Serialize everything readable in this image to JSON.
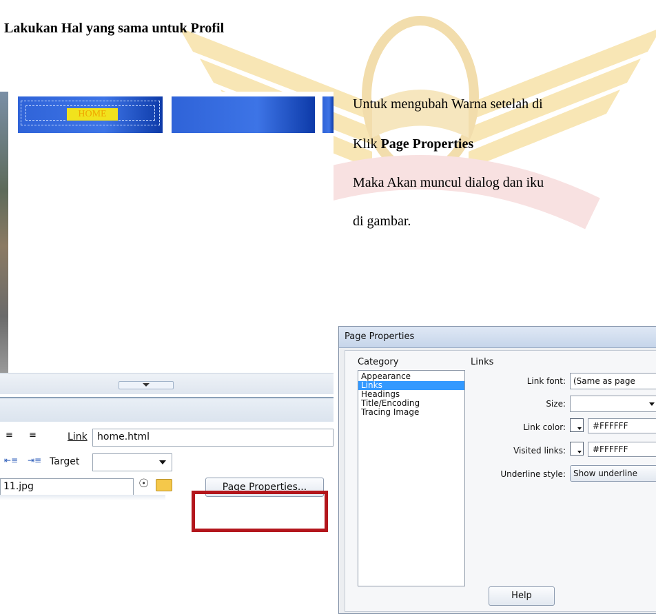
{
  "heading": {
    "text": "Lakukan Hal yang sama untuk Profil"
  },
  "instructions": {
    "line1": "Untuk mengubah Warna setelah di",
    "line2_prefix": "Klik",
    "line2_bold": "Page Properties",
    "line3": "Maka Akan muncul dialog dan iku",
    "line4": "di gambar."
  },
  "editor": {
    "nav_button_label": "HOME",
    "properties": {
      "link_label": "Link",
      "link_value": "home.html",
      "target_label": "Target",
      "target_value": "",
      "src_value": "11.jpg",
      "page_properties_button": "Page Properties..."
    }
  },
  "dialog": {
    "title": "Page Properties",
    "category_label": "Category",
    "section_label": "Links",
    "categories": [
      "Appearance",
      "Links",
      "Headings",
      "Title/Encoding",
      "Tracing Image"
    ],
    "selected_category_index": 1,
    "fields": {
      "link_font_label": "Link font:",
      "link_font_value": "(Same as page",
      "size_label": "Size:",
      "size_value": "",
      "link_color_label": "Link color:",
      "link_color_value": "#FFFFFF",
      "visited_links_label": "Visited links:",
      "visited_links_value": "#FFFFFF",
      "underline_style_label": "Underline style:",
      "underline_style_value": "Show underline"
    },
    "help_button": "Help"
  },
  "colors": {
    "nav_blue": "#2f63d8",
    "highlight_yellow": "#f1e21d",
    "selection_blue": "#3399ff",
    "red_box": "#b3161c"
  }
}
